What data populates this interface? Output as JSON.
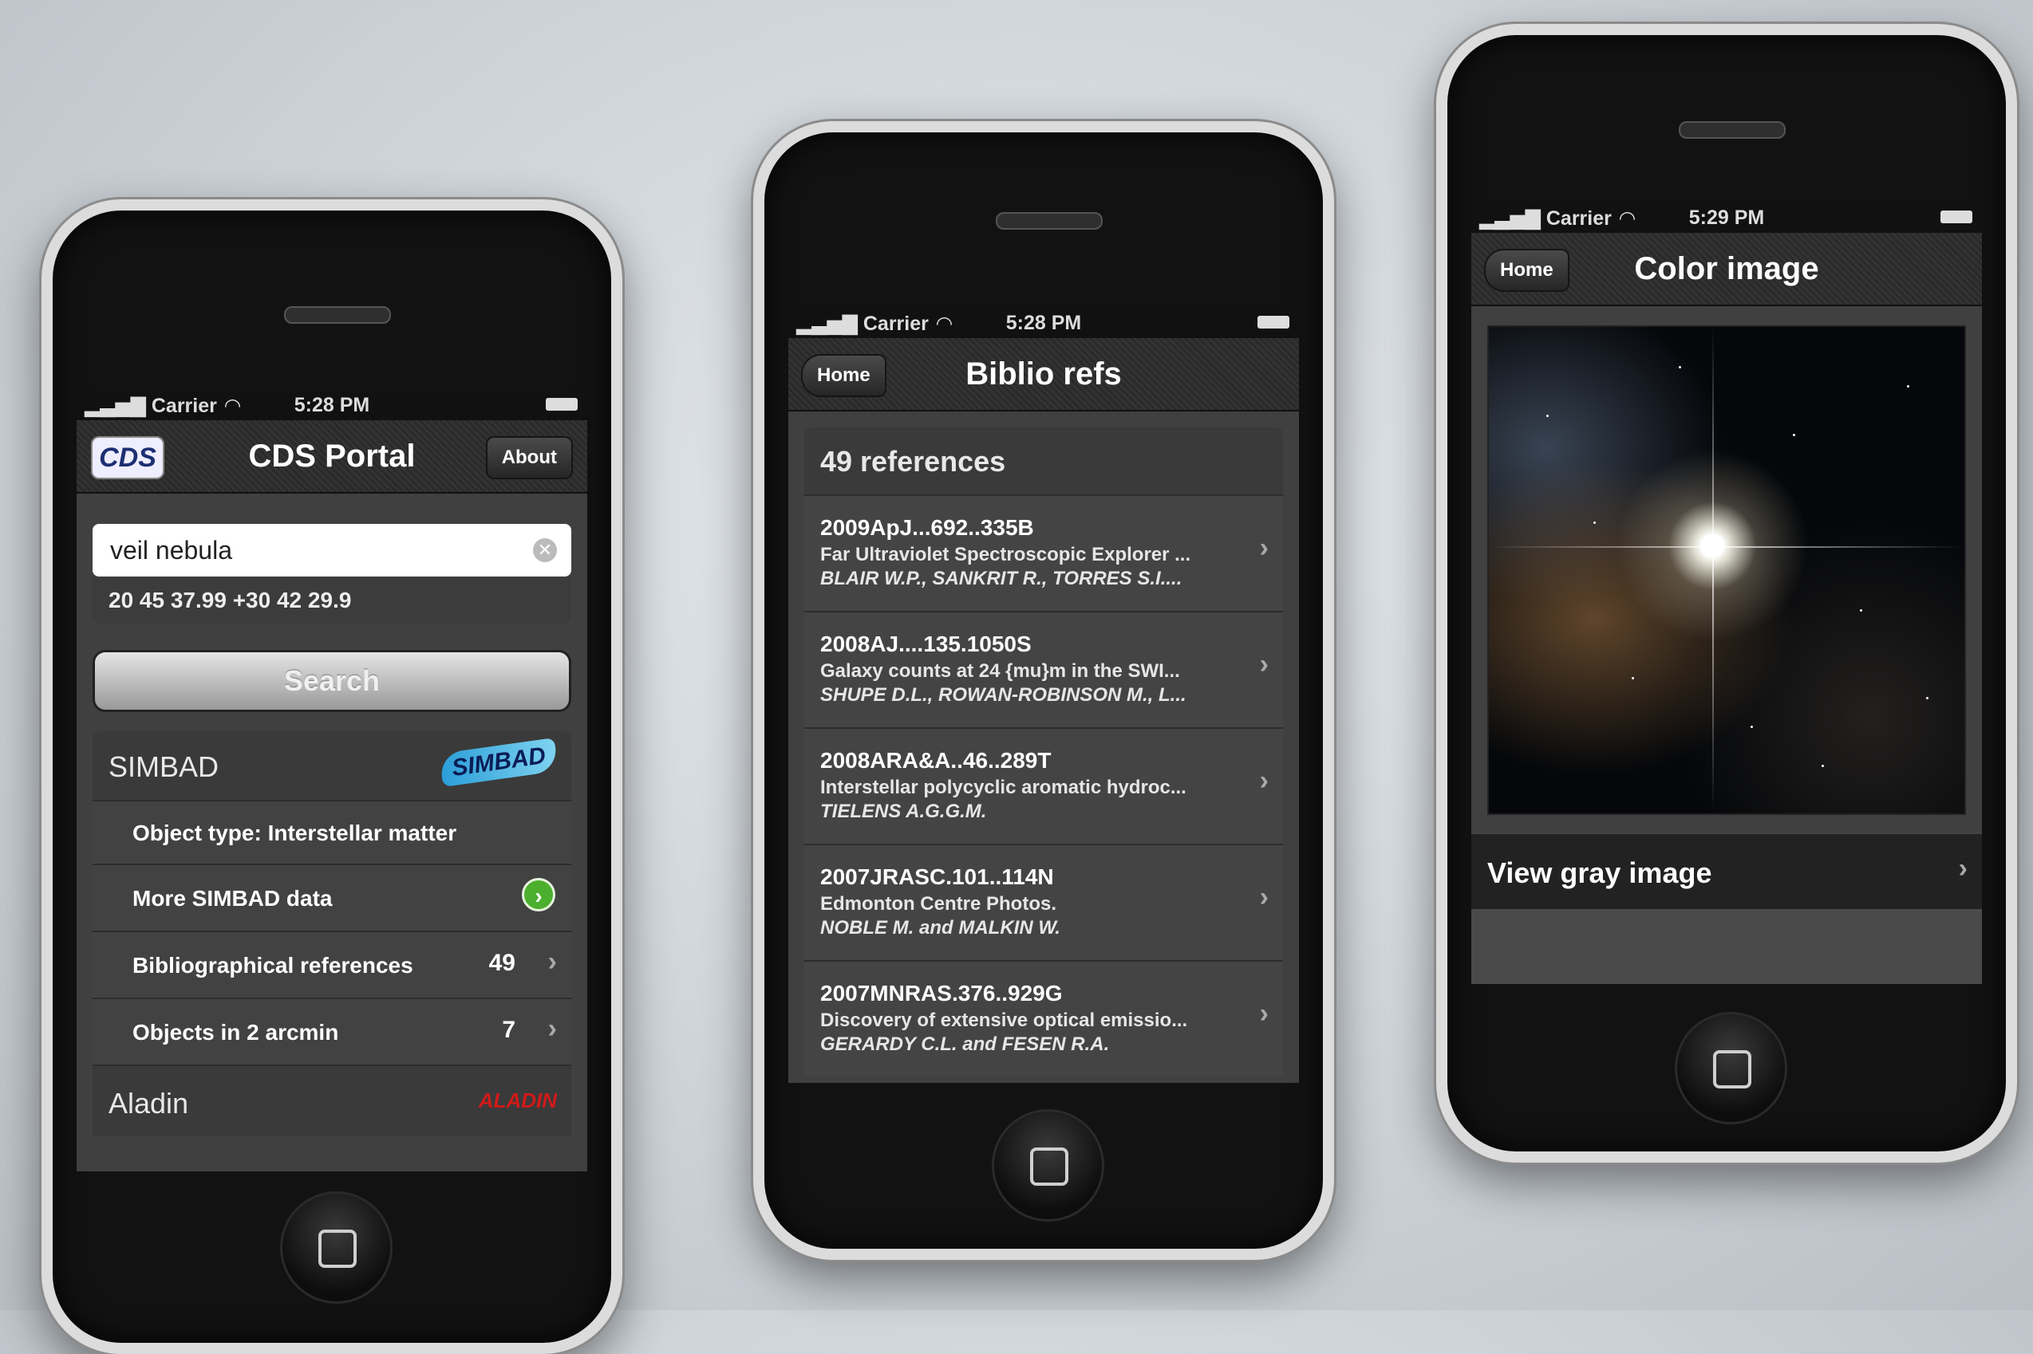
{
  "status_bar": {
    "carrier": "Carrier",
    "signal_icon": "signal-bars-icon",
    "wifi_icon": "wifi-icon",
    "battery_icon": "battery-icon"
  },
  "phone1": {
    "time": "5:28 PM",
    "title": "CDS Portal",
    "logo_text": "CDS",
    "about_label": "About",
    "search": {
      "value": "veil nebula",
      "coords": "20 45 37.99 +30 42 29.9"
    },
    "search_button": "Search",
    "simbad": {
      "header": "SIMBAD",
      "logo_text": "SIMBAD",
      "rows": [
        {
          "label": "Object type: Interstellar matter"
        },
        {
          "label": "More SIMBAD data"
        },
        {
          "label": "Bibliographical references",
          "count": "49"
        },
        {
          "label": "Objects in 2 arcmin",
          "count": "7"
        }
      ]
    },
    "aladin": {
      "header": "Aladin",
      "logo_text": "ALADIN"
    }
  },
  "phone2": {
    "time": "5:28 PM",
    "back_label": "Home",
    "title": "Biblio refs",
    "count_header": "49 references",
    "refs": [
      {
        "code": "2009ApJ...692..335B",
        "title": "Far Ultraviolet Spectroscopic Explorer ...",
        "authors": "BLAIR W.P., SANKRIT R., TORRES S.I...."
      },
      {
        "code": "2008AJ....135.1050S",
        "title": "Galaxy counts at 24 {mu}m in the SWI...",
        "authors": "SHUPE D.L., ROWAN-ROBINSON M., L..."
      },
      {
        "code": "2008ARA&A..46..289T",
        "title": "Interstellar polycyclic aromatic hydroc...",
        "authors": "TIELENS A.G.G.M."
      },
      {
        "code": "2007JRASC.101..114N",
        "title": "Edmonton Centre Photos.",
        "authors": "NOBLE M. and MALKIN W."
      },
      {
        "code": "2007MNRAS.376..929G",
        "title": "Discovery of extensive optical emissio...",
        "authors": "GERARDY C.L. and FESEN R.A."
      }
    ]
  },
  "phone3": {
    "time": "5:29 PM",
    "back_label": "Home",
    "title": "Color image",
    "view_gray_label": "View gray image"
  }
}
